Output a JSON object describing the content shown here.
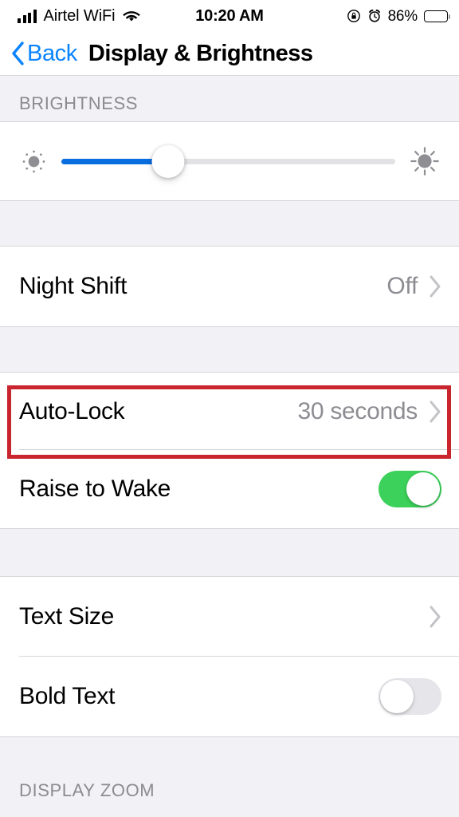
{
  "status_bar": {
    "carrier": "Airtel WiFi",
    "time": "10:20 AM",
    "battery_percent": "86%",
    "signal_icon": "cellular-signal-icon",
    "wifi_icon": "wifi-icon",
    "rotation_lock_icon": "rotation-lock-icon",
    "alarm_icon": "alarm-clock-icon",
    "battery_icon": "battery-icon"
  },
  "nav": {
    "back_label": "Back",
    "title": "Display & Brightness"
  },
  "sections": {
    "brightness": {
      "header": "BRIGHTNESS",
      "slider": {
        "value_percent": 32,
        "min_icon": "sun-low-icon",
        "max_icon": "sun-high-icon"
      }
    },
    "night_shift": {
      "label": "Night Shift",
      "value": "Off",
      "chevron": "chevron-right-icon"
    },
    "auto_lock_group": {
      "auto_lock": {
        "label": "Auto-Lock",
        "value": "30 seconds",
        "chevron": "chevron-right-icon",
        "highlighted": true
      },
      "raise_to_wake": {
        "label": "Raise to Wake",
        "toggle_state": "on"
      }
    },
    "text_group": {
      "text_size": {
        "label": "Text Size",
        "chevron": "chevron-right-icon"
      },
      "bold_text": {
        "label": "Bold Text",
        "toggle_state": "off"
      }
    },
    "display_zoom": {
      "header": "DISPLAY ZOOM"
    }
  },
  "colors": {
    "accent_blue": "#0a84ff",
    "slider_blue": "#0a6ee0",
    "toggle_on_green": "#3bd15a",
    "highlight_red": "#c8252e",
    "secondary_text": "#8c8c92",
    "group_background": "#f2f1f5"
  }
}
